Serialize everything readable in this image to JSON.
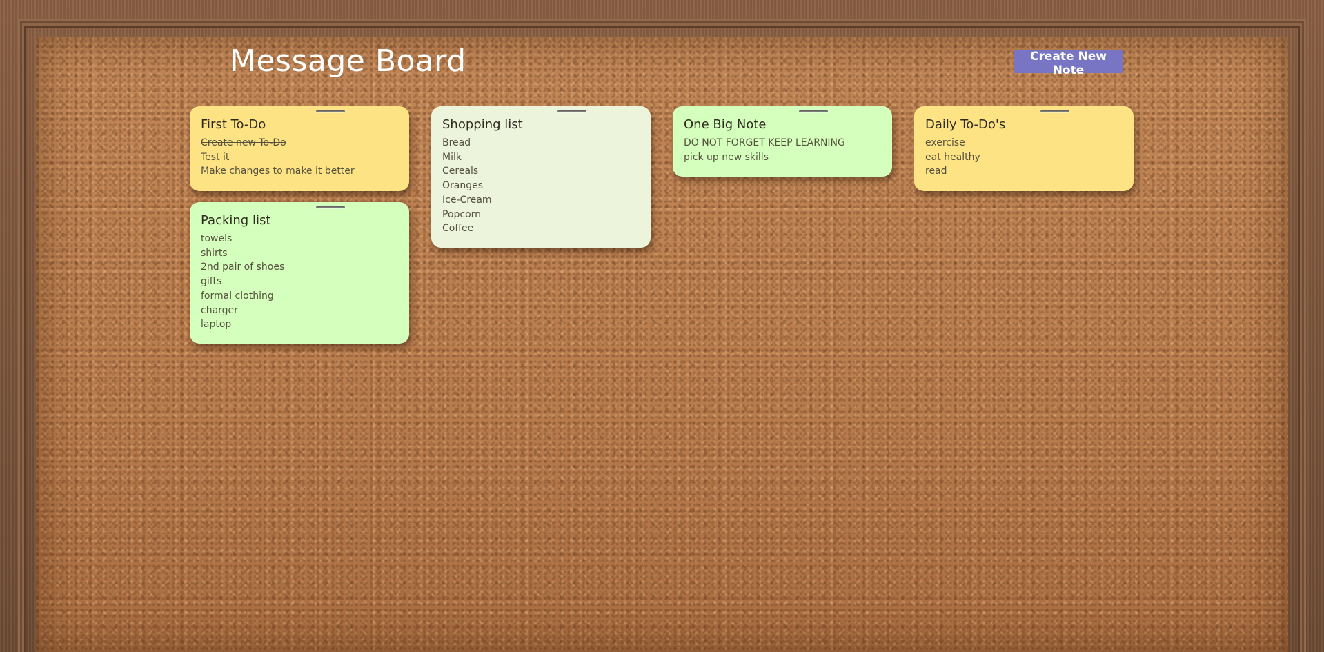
{
  "header": {
    "title": "Message Board",
    "create_button_label": "Create New Note"
  },
  "colors": {
    "yellow_note": "#fde383",
    "green_note": "#d5ffbc",
    "pale_note": "#edf4dc",
    "button": "#7876c4",
    "cork": "#c08456"
  },
  "notes": [
    {
      "title": "First To-Do",
      "color": "yellow",
      "items": [
        {
          "text": "Create new To-Do",
          "done": true
        },
        {
          "text": "Test it",
          "done": true
        },
        {
          "text": "Make changes to make it better",
          "done": false
        }
      ]
    },
    {
      "title": "Packing list",
      "color": "green",
      "items": [
        {
          "text": "towels",
          "done": false
        },
        {
          "text": "shirts",
          "done": false
        },
        {
          "text": "2nd pair of shoes",
          "done": false
        },
        {
          "text": "gifts",
          "done": false
        },
        {
          "text": "formal clothing",
          "done": false
        },
        {
          "text": "charger",
          "done": false
        },
        {
          "text": "laptop",
          "done": false
        }
      ]
    },
    {
      "title": "Shopping list",
      "color": "pale",
      "items": [
        {
          "text": "Bread",
          "done": false
        },
        {
          "text": "Milk",
          "done": true
        },
        {
          "text": "Cereals",
          "done": false
        },
        {
          "text": "Oranges",
          "done": false
        },
        {
          "text": "Ice-Cream",
          "done": false
        },
        {
          "text": "Popcorn",
          "done": false
        },
        {
          "text": "Coffee",
          "done": false
        }
      ]
    },
    {
      "title": "One Big Note",
      "color": "green",
      "items": [
        {
          "text": "DO NOT FORGET KEEP LEARNING",
          "done": false
        },
        {
          "text": "pick up new skills",
          "done": false
        }
      ]
    },
    {
      "title": "Daily To-Do's",
      "color": "yellow",
      "items": [
        {
          "text": "exercise",
          "done": false
        },
        {
          "text": "eat healthy",
          "done": false
        },
        {
          "text": "read",
          "done": false
        }
      ]
    }
  ]
}
